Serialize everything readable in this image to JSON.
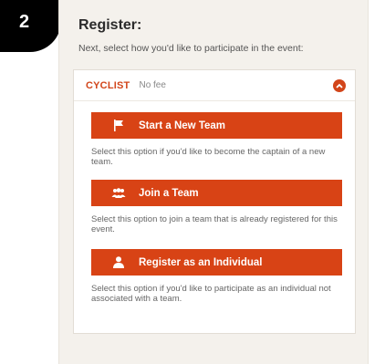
{
  "step": {
    "number": "2"
  },
  "header": {
    "title": "Register:",
    "subtitle": "Next, select how you'd like to participate in the event:"
  },
  "participation": {
    "category": "CYCLIST",
    "fee": "No fee",
    "collapse_icon": "chevron-up-icon",
    "accent_color": "#d84315",
    "options": [
      {
        "label": "Start a New Team",
        "icon": "flag-icon",
        "description": "Select this option if you'd like to become the captain of a new team."
      },
      {
        "label": "Join a Team",
        "icon": "group-icon",
        "description": "Select this option to join a team that is already registered for this event."
      },
      {
        "label": "Register as an Individual",
        "icon": "person-icon",
        "description": "Select this option if you'd like to participate as an individual not associated with a team."
      }
    ]
  }
}
